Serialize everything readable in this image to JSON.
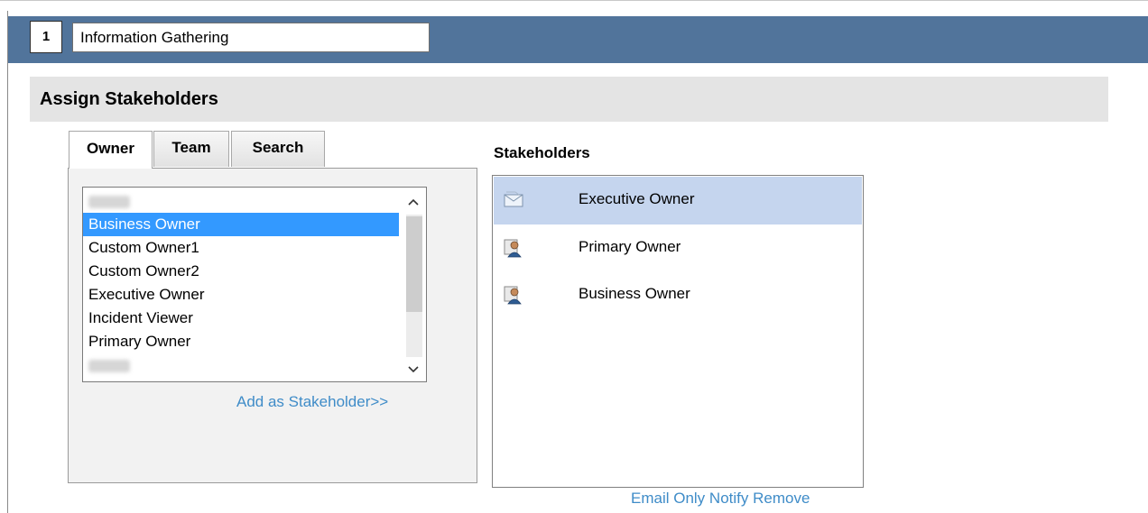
{
  "step": {
    "number": "1",
    "title": "Information Gathering"
  },
  "section": {
    "title": "Assign Stakeholders"
  },
  "tabs": [
    {
      "label": "Owner",
      "active": true
    },
    {
      "label": "Team",
      "active": false
    },
    {
      "label": "Search",
      "active": false
    }
  ],
  "owner_list": {
    "items": [
      {
        "label": "",
        "blurred": true,
        "selected": false
      },
      {
        "label": "Business Owner",
        "blurred": false,
        "selected": true
      },
      {
        "label": "Custom Owner1",
        "blurred": false,
        "selected": false
      },
      {
        "label": "Custom Owner2",
        "blurred": false,
        "selected": false
      },
      {
        "label": "Executive Owner",
        "blurred": false,
        "selected": false
      },
      {
        "label": "Incident Viewer",
        "blurred": false,
        "selected": false
      },
      {
        "label": "Primary Owner",
        "blurred": false,
        "selected": false
      },
      {
        "label": "",
        "blurred": true,
        "selected": false
      }
    ],
    "add_link": "Add as Stakeholder>>"
  },
  "stakeholders": {
    "label": "Stakeholders",
    "items": [
      {
        "name": "Executive Owner",
        "icon": "envelope-icon",
        "selected": true
      },
      {
        "name": "Primary Owner",
        "icon": "user-card-icon",
        "selected": false
      },
      {
        "name": "Business Owner",
        "icon": "user-card-icon",
        "selected": false
      }
    ],
    "actions": {
      "email_only": "Email Only",
      "notify": "Notify",
      "remove": "Remove"
    }
  },
  "colors": {
    "step_bar": "#51749b",
    "section_header_bg": "#e4e4e4",
    "selection_blue": "#3399ff",
    "stakeholder_selected": "#c5d5ee",
    "link": "#3f8cc8"
  }
}
